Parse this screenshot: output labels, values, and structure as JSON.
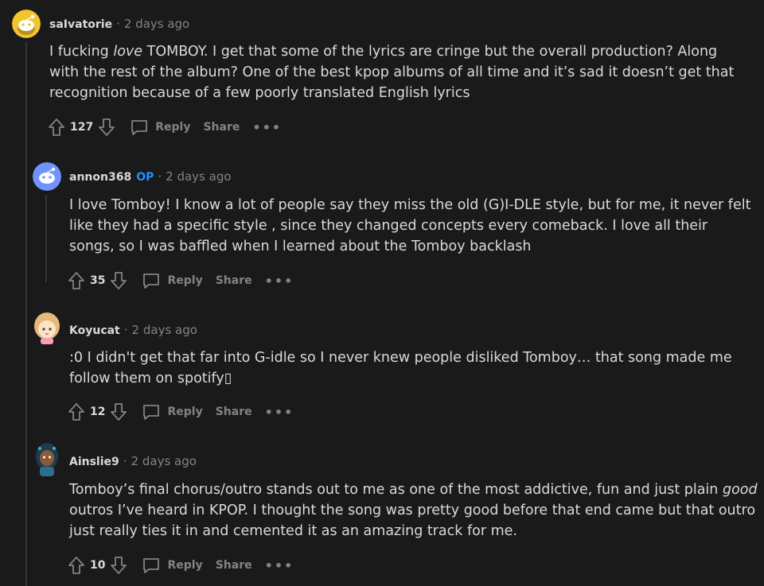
{
  "comments": [
    {
      "author": "saIvatorie",
      "op_badge": "",
      "separator": "·",
      "time": "2 days ago",
      "body_before": "I fucking ",
      "body_em": "love",
      "body_after": " TOMBOY. I get that some of the lyrics are cringe but the overall production? Along with the rest of the album? One of the best kpop albums of all time and it’s sad it doesn’t get that recognition because of a few poorly translated English lyrics",
      "score": "127",
      "reply_label": "Reply",
      "share_label": "Share",
      "more_label": "•••",
      "avatar_color": "#f4c430"
    },
    {
      "author": "annon368",
      "op_badge": "OP",
      "separator": "·",
      "time": "2 days ago",
      "body": "I love Tomboy! I know a lot of people say they miss the old (G)I-DLE style, but for me, it never felt like they had a specific style , since they changed concepts every comeback. I love all their songs, so I was baffled when I learned about the Tomboy backlash",
      "score": "35",
      "reply_label": "Reply",
      "share_label": "Share",
      "more_label": "•••",
      "avatar_color": "#7193ff"
    },
    {
      "author": "Koyucat",
      "separator": "·",
      "time": "2 days ago",
      "body": ":0 I didn't get that far into G-idle so I never knew people disliked Tomboy… that song made me follow them on spotify▯",
      "score": "12",
      "reply_label": "Reply",
      "share_label": "Share",
      "more_label": "•••",
      "avatar_color": "#f3d3a4"
    },
    {
      "author": "Ainslie9",
      "separator": "·",
      "time": "2 days ago",
      "body_before": "Tomboy’s final chorus/outro stands out to me as one of the most addictive, fun and just plain ",
      "body_em": "good",
      "body_after": " outros I’ve heard in KPOP. I thought the song was pretty good before that end came but that outro just really ties it in and cemented it as an amazing track for me.",
      "score": "10",
      "reply_label": "Reply",
      "share_label": "Share",
      "more_label": "•••",
      "avatar_color": "#1f3b4d"
    }
  ]
}
